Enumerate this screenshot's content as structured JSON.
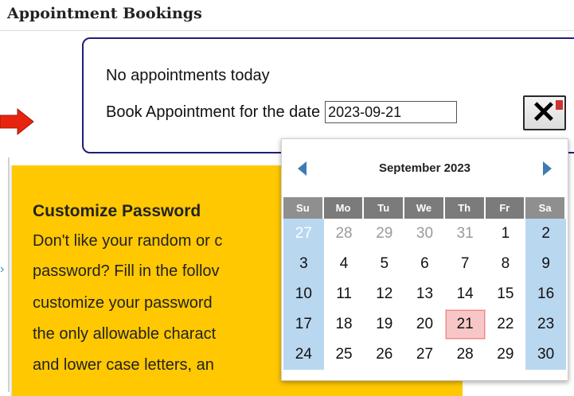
{
  "page": {
    "heading": "Appointment Bookings"
  },
  "appointments": {
    "status": "No appointments today",
    "book_label": "Book Appointment for the date",
    "date_value": "2023-09-21"
  },
  "password_panel": {
    "title": "Customize Password",
    "lines": [
      "Don't like your random or c",
      "password? Fill in the follov",
      "customize your password",
      "the only allowable charact",
      "and lower case letters, an"
    ]
  },
  "datepicker": {
    "month_label": "September 2023",
    "weekdays": [
      "Su",
      "Mo",
      "Tu",
      "We",
      "Th",
      "Fr",
      "Sa"
    ],
    "weeks": [
      [
        "27",
        "28",
        "29",
        "30",
        "31",
        "1",
        "2"
      ],
      [
        "3",
        "4",
        "5",
        "6",
        "7",
        "8",
        "9"
      ],
      [
        "10",
        "11",
        "12",
        "13",
        "14",
        "15",
        "16"
      ],
      [
        "17",
        "18",
        "19",
        "20",
        "21",
        "22",
        "23"
      ],
      [
        "24",
        "25",
        "26",
        "27",
        "28",
        "29",
        "30"
      ]
    ],
    "selected": "21",
    "accent_color": "#3d7cb3",
    "weekend_color": "#bad7f0",
    "selected_color": "#f7c7c7"
  },
  "colors": {
    "panel_yellow": "#ffc800",
    "panel_border": "#1f1f7a",
    "arrow_red": "#e8240f"
  }
}
